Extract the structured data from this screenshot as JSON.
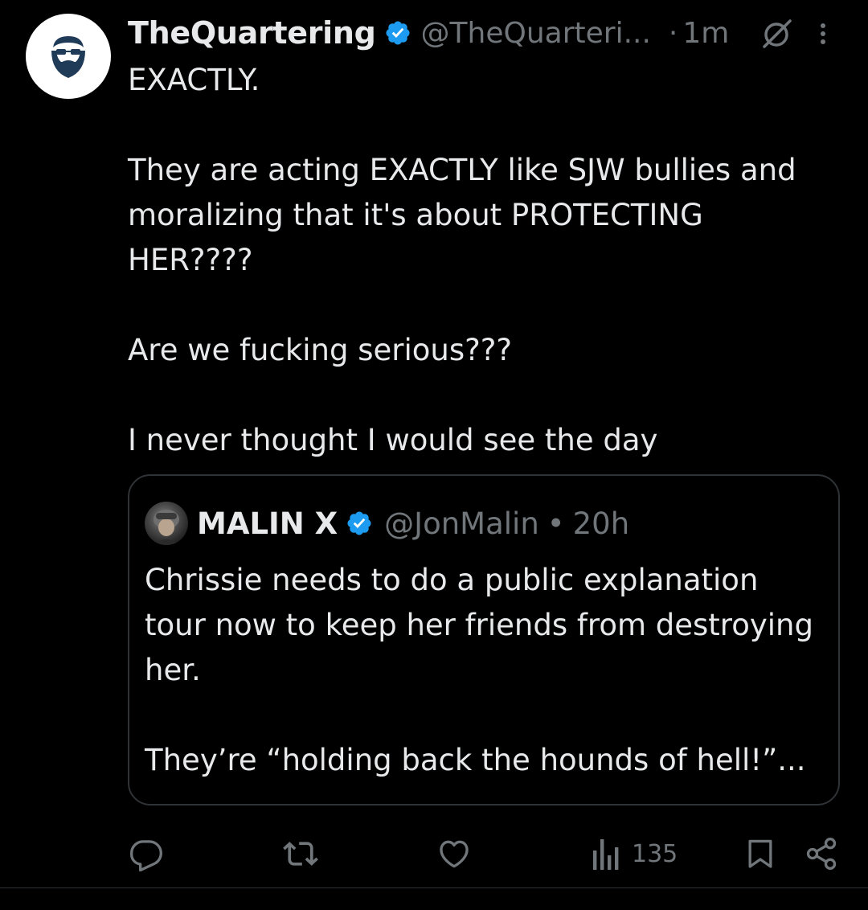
{
  "tweet": {
    "author": {
      "display_name": "TheQuartering",
      "handle": "@TheQuarteri...",
      "verified": true
    },
    "separator": "·",
    "time": "1m",
    "text": "EXACTLY.\n\nThey are acting EXACTLY like SJW bullies and moralizing that it's about PROTECTING HER????\n\nAre we fucking serious???\n\nI never thought I would see the day"
  },
  "quoted_tweet": {
    "author": {
      "display_name": "MALIN X",
      "handle": "@JonMalin",
      "verified": true
    },
    "separator": "•",
    "time": "20h",
    "text": "Chrissie needs to do a public explanation tour now to keep her friends from destroying her.\n\nThey’re “holding back the hounds of hell!”..."
  },
  "actions": {
    "reply_icon": "reply-icon",
    "repost_icon": "repost-icon",
    "like_icon": "heart-icon",
    "views_icon": "views-icon",
    "views_count": "135",
    "bookmark_icon": "bookmark-icon",
    "share_icon": "share-icon"
  },
  "colors": {
    "background": "#000000",
    "text_primary": "#e7e9ea",
    "text_secondary": "#71767b",
    "verified_blue": "#1d9bf0",
    "border": "#2f3336"
  }
}
